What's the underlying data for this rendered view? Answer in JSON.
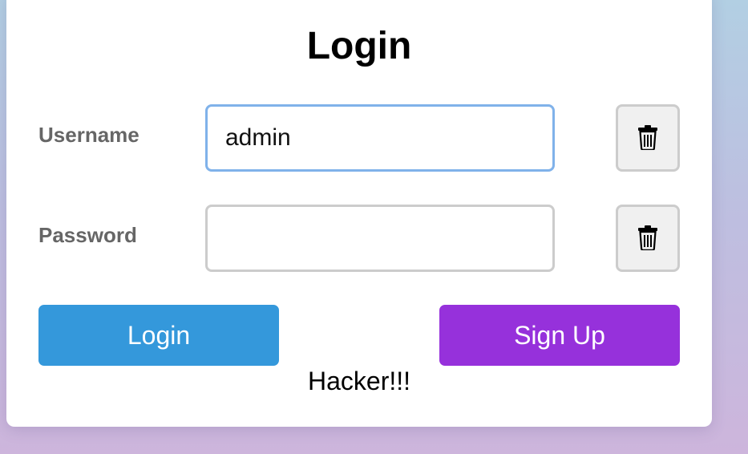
{
  "form": {
    "title": "Login",
    "username": {
      "label": "Username",
      "value": "admin",
      "placeholder": ""
    },
    "password": {
      "label": "Password",
      "value": "",
      "placeholder": ""
    },
    "login_label": "Login",
    "signup_label": "Sign Up",
    "message": "Hacker!!!"
  },
  "icons": {
    "username_clear": "trash-icon",
    "password_clear": "trash-icon"
  },
  "colors": {
    "login_button": "#3498db",
    "signup_button": "#9631db",
    "focus_border": "#80b2ea",
    "label_text": "#666666"
  }
}
